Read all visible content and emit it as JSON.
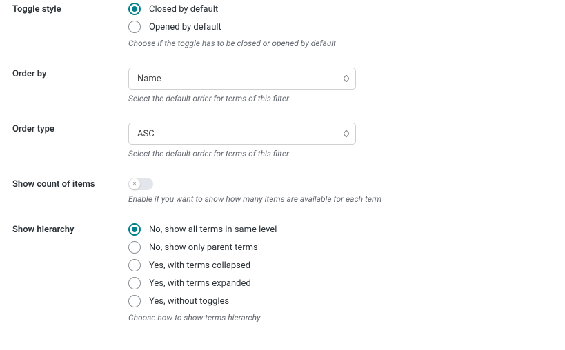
{
  "toggle_style": {
    "label": "Toggle style",
    "options": [
      {
        "label": "Closed by default",
        "selected": true
      },
      {
        "label": "Opened by default",
        "selected": false
      }
    ],
    "description": "Choose if the toggle has to be closed or opened by default"
  },
  "order_by": {
    "label": "Order by",
    "value": "Name",
    "description": "Select the default order for terms of this filter"
  },
  "order_type": {
    "label": "Order type",
    "value": "ASC",
    "description": "Select the default order for terms of this filter"
  },
  "show_count": {
    "label": "Show count of items",
    "x": "×",
    "description": "Enable if you want to show how many items are available for each term"
  },
  "show_hierarchy": {
    "label": "Show hierarchy",
    "options": [
      {
        "label": "No, show all terms in same level",
        "selected": true
      },
      {
        "label": "No, show only parent terms",
        "selected": false
      },
      {
        "label": "Yes, with terms collapsed",
        "selected": false
      },
      {
        "label": "Yes, with terms expanded",
        "selected": false
      },
      {
        "label": "Yes, without toggles",
        "selected": false
      }
    ],
    "description": "Choose how to show terms hierarchy"
  }
}
